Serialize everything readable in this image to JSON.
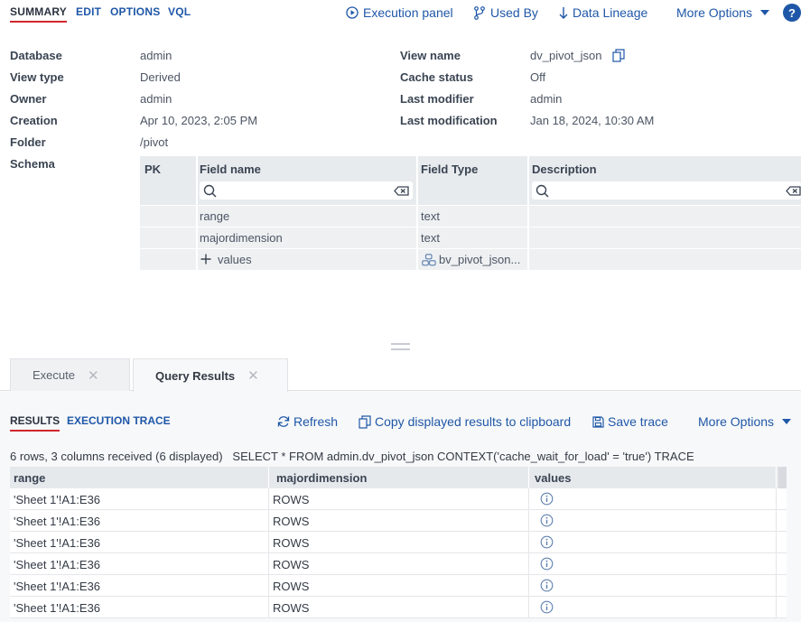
{
  "top_tabs": [
    "SUMMARY",
    "EDIT",
    "OPTIONS",
    "VQL"
  ],
  "toolbar": {
    "execution_panel": "Execution panel",
    "used_by": "Used By",
    "data_lineage": "Data Lineage",
    "more_options": "More Options",
    "help": "?"
  },
  "properties": {
    "left": [
      {
        "label": "Database",
        "value": "admin"
      },
      {
        "label": "View type",
        "value": "Derived"
      },
      {
        "label": "Owner",
        "value": "admin"
      },
      {
        "label": "Creation",
        "value": "Apr 10, 2023, 2:05 PM"
      },
      {
        "label": "Folder",
        "value": "/pivot"
      },
      {
        "label": "Schema",
        "value": ""
      }
    ],
    "right": [
      {
        "label": "View name",
        "value": "dv_pivot_json"
      },
      {
        "label": "Cache status",
        "value": "Off"
      },
      {
        "label": "Last modifier",
        "value": "admin"
      },
      {
        "label": "Last modification",
        "value": "Jan 18, 2024, 10:30 AM"
      }
    ]
  },
  "schema": {
    "columns": [
      "PK",
      "Field name",
      "Field Type",
      "Description"
    ],
    "rows": [
      {
        "pk": "",
        "name": "range",
        "type": "text",
        "description": ""
      },
      {
        "pk": "",
        "name": "majordimension",
        "type": "text",
        "description": ""
      },
      {
        "pk": "",
        "name": "values",
        "type": "bv_pivot_json...",
        "description": ""
      }
    ]
  },
  "bottom_tabs": [
    {
      "label": "Execute",
      "active": false
    },
    {
      "label": "Query Results",
      "active": true
    }
  ],
  "results": {
    "tabs": [
      "RESULTS",
      "EXECUTION TRACE"
    ],
    "toolbar": {
      "refresh": "Refresh",
      "copy": "Copy displayed results to clipboard",
      "save_trace": "Save trace",
      "more_options": "More Options"
    },
    "status": "6 rows, 3 columns received (6 displayed)",
    "query": "SELECT * FROM admin.dv_pivot_json CONTEXT('cache_wait_for_load' = 'true') TRACE",
    "columns": [
      "range",
      "majordimension",
      "values"
    ],
    "rows": [
      {
        "range": "'Sheet 1'!A1:E36",
        "majordimension": "ROWS"
      },
      {
        "range": "'Sheet 1'!A1:E36",
        "majordimension": "ROWS"
      },
      {
        "range": "'Sheet 1'!A1:E36",
        "majordimension": "ROWS"
      },
      {
        "range": "'Sheet 1'!A1:E36",
        "majordimension": "ROWS"
      },
      {
        "range": "'Sheet 1'!A1:E36",
        "majordimension": "ROWS"
      },
      {
        "range": "'Sheet 1'!A1:E36",
        "majordimension": "ROWS"
      }
    ]
  },
  "colors": {
    "link": "#1f57a8",
    "active_underline": "#d1262d",
    "header_bg": "#e8ebee"
  }
}
